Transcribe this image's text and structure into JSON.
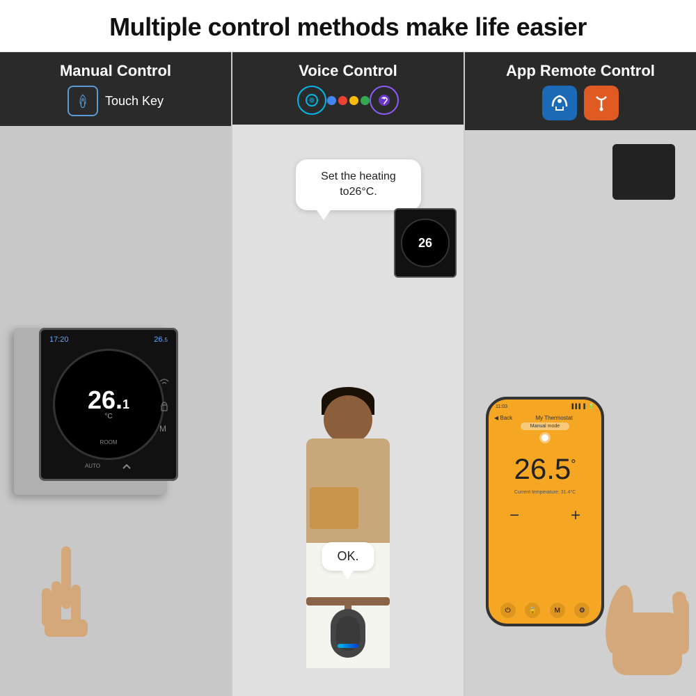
{
  "header": {
    "title": "Multiple control methods make life easier"
  },
  "columns": [
    {
      "id": "manual",
      "heading": "Manual Control",
      "subheading": "Touch Key",
      "icon_type": "touch-key",
      "thermostat": {
        "time": "17:20",
        "set_temp": "26.5",
        "display_temp": "26.1",
        "unit": "°C",
        "mode": "AUTO",
        "status": "ROOM"
      }
    },
    {
      "id": "voice",
      "heading": "Voice Control",
      "icons": [
        "alexa",
        "google",
        "siri"
      ],
      "speech_bubble": "Set the heating to26°C.",
      "ok_bubble": "OK.",
      "mini_thermostat_temp": "26"
    },
    {
      "id": "app",
      "heading": "App Remote Control",
      "icons": [
        "smartlife",
        "tuya"
      ],
      "phone": {
        "time": "11:03",
        "title": "My Thermostat",
        "mode": "Manual mode",
        "temperature": "26.5",
        "unit": "°",
        "current_temp": "Current temperature: 31.4°C"
      }
    }
  ]
}
